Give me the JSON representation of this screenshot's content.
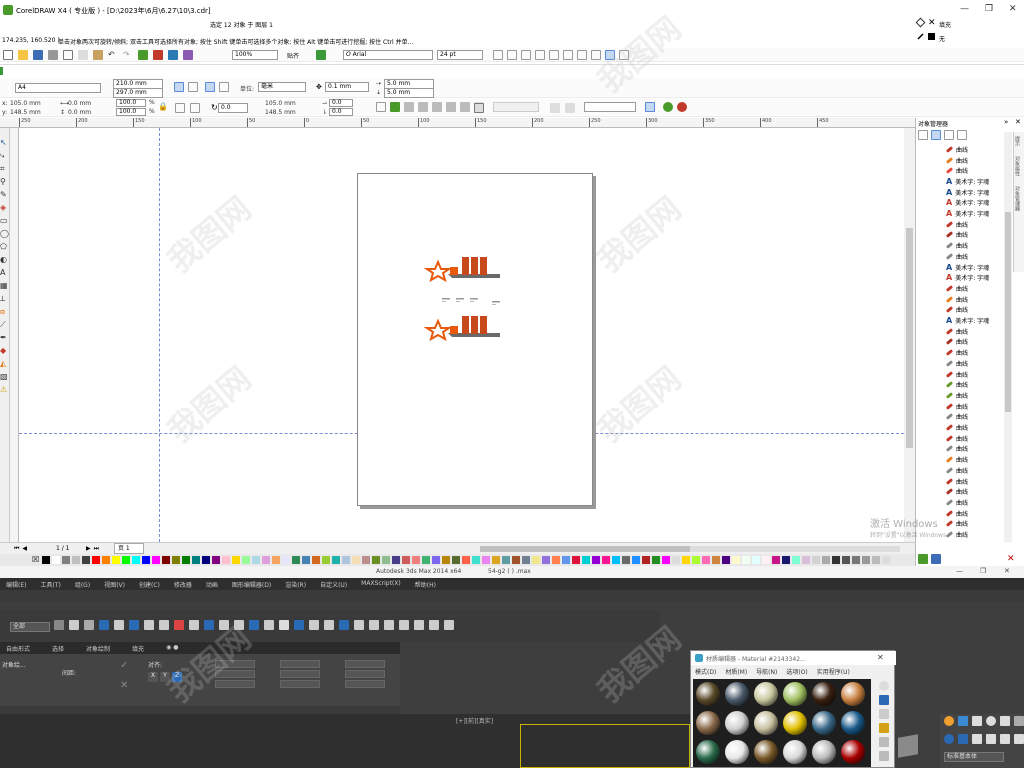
{
  "titlebar": {
    "app_title": "CorelDRAW X4 ( 专业版 ) - [D:\\2023年\\6月\\6.27\\10\\3.cdr]",
    "selection_info": "选定 12 对象 于 图层 1",
    "fill_label": "填充",
    "outline_label": "无",
    "minimize": "—",
    "restore": "❐",
    "close": "✕"
  },
  "status": {
    "coords": "174.235, 160.520 )",
    "hint": "单击对象两次可旋转/倾斜; 双击工具可选择所有对象; 按住 Shift 键单击可选择多个对象; 按住 Alt 键单击可进行挖掘; 按住 Ctrl 并单..."
  },
  "toolbar": {
    "zoom": "100%",
    "snap_label": "贴齐",
    "font_name": "Arial",
    "font_size": "24 pt"
  },
  "propbar": {
    "paper": "A4",
    "width": "210.0 mm",
    "height": "297.0 mm",
    "unit_label": "单位:",
    "unit": "毫米",
    "nudge": "0.1 mm",
    "dup_x": "5.0 mm",
    "dup_y": "5.0 mm"
  },
  "transform": {
    "x": "105.0 mm",
    "y": "148.5 mm",
    "w": "0.0 mm",
    "h": "0.0 mm",
    "sx": "100.0",
    "sy": "100.0",
    "pct": "%",
    "angle": "0.0",
    "cx": "105.0 mm",
    "cy": "148.5 mm",
    "skx": "0.0",
    "sky": "0.0"
  },
  "ruler": {
    "top_ticks": [
      "250",
      "200",
      "150",
      "100",
      "50",
      "0",
      "50",
      "100",
      "150",
      "200",
      "250",
      "300",
      "350",
      "400",
      "450"
    ]
  },
  "object_manager": {
    "title": "对象管理器",
    "items": [
      {
        "type": "curve",
        "label": "曲线",
        "color": "#c0392b"
      },
      {
        "type": "curve",
        "label": "曲线",
        "color": "#e67e22"
      },
      {
        "type": "curve",
        "label": "曲线",
        "color": "#e74c3c"
      },
      {
        "type": "text",
        "label": "美术字: 字魂"
      },
      {
        "type": "text",
        "label": "美术字: 字魂"
      },
      {
        "type": "text",
        "label": "美术字: 字魂",
        "color": "#c0392b"
      },
      {
        "type": "text",
        "label": "美术字: 字魂",
        "color": "#c0392b"
      },
      {
        "type": "curve",
        "label": "曲线",
        "color": "#c0392b"
      },
      {
        "type": "curve",
        "label": "曲线",
        "color": "#a93226"
      },
      {
        "type": "curve",
        "label": "曲线",
        "color": "#888"
      },
      {
        "type": "curve",
        "label": "曲线",
        "color": "#888"
      },
      {
        "type": "text",
        "label": "美术字: 字魂"
      },
      {
        "type": "text",
        "label": "美术字: 字魂",
        "color": "#c0392b"
      },
      {
        "type": "curve",
        "label": "曲线",
        "color": "#c0392b"
      },
      {
        "type": "curve",
        "label": "曲线",
        "color": "#e67e22"
      },
      {
        "type": "curve",
        "label": "曲线",
        "color": "#c0392b"
      },
      {
        "type": "text",
        "label": "美术字: 字魂"
      },
      {
        "type": "curve",
        "label": "曲线",
        "color": "#c0392b"
      },
      {
        "type": "curve",
        "label": "曲线",
        "color": "#a93226"
      },
      {
        "type": "curve",
        "label": "曲线",
        "color": "#c0392b"
      },
      {
        "type": "curve",
        "label": "曲线",
        "color": "#888"
      },
      {
        "type": "curve",
        "label": "曲线",
        "color": "#c0392b"
      },
      {
        "type": "curve",
        "label": "曲线",
        "color": "#6a9a2a"
      },
      {
        "type": "curve",
        "label": "曲线",
        "color": "#6a9a2a"
      },
      {
        "type": "curve",
        "label": "曲线",
        "color": "#c0392b"
      },
      {
        "type": "curve",
        "label": "曲线",
        "color": "#888"
      },
      {
        "type": "curve",
        "label": "曲线",
        "color": "#c0392b"
      },
      {
        "type": "curve",
        "label": "曲线",
        "color": "#c0392b"
      },
      {
        "type": "curve",
        "label": "曲线",
        "color": "#888"
      },
      {
        "type": "curve",
        "label": "曲线",
        "color": "#e67e22"
      },
      {
        "type": "curve",
        "label": "曲线",
        "color": "#888"
      },
      {
        "type": "curve",
        "label": "曲线",
        "color": "#c0392b"
      },
      {
        "type": "curve",
        "label": "曲线",
        "color": "#a93226"
      },
      {
        "type": "curve",
        "label": "曲线",
        "color": "#888"
      },
      {
        "type": "curve",
        "label": "曲线",
        "color": "#c0392b"
      },
      {
        "type": "curve",
        "label": "曲线",
        "color": "#c0392b"
      },
      {
        "type": "curve",
        "label": "曲线",
        "color": "#888"
      }
    ]
  },
  "pagenav": {
    "count": "1 / 1",
    "tab": "页 1"
  },
  "watermark_text": "激活 Windows",
  "watermark_sub": "转到\"设置\"以激活 Windows。",
  "max": {
    "title": "Autodesk 3ds Max 2014 x64",
    "file": "54-g2 ( ) .max",
    "menu": [
      "自由形式",
      "选择",
      "对象绘制",
      "填充",
      "◉ ●"
    ],
    "main_menu": [
      "编辑(E)",
      "工具(T)",
      "组(G)",
      "视图(V)",
      "创建(C)",
      "修改器",
      "动画",
      "图形编辑器(D)",
      "渲染(R)",
      "自定义(U)",
      "MAXScript(X)",
      "帮助(H)"
    ],
    "mat_editor": "材质编辑器 - Material #2143342...",
    "mat_menu": [
      "模式(D)",
      "材质(M)",
      "导航(N)",
      "选项(O)",
      "实用程序(U)"
    ]
  },
  "palette": [
    "#000",
    "#fff",
    "#808080",
    "#c0c0c0",
    "#404040",
    "#ff0000",
    "#ff8000",
    "#ffff00",
    "#00ff00",
    "#00ffff",
    "#0000ff",
    "#ff00ff",
    "#800000",
    "#808000",
    "#008000",
    "#008080",
    "#000080",
    "#800080",
    "#ffc0cb",
    "#ffd700",
    "#98fb98",
    "#add8e6",
    "#dda0dd",
    "#f4a460",
    "#e6e6fa",
    "#2e8b57",
    "#4682b4",
    "#d2691e",
    "#9acd32",
    "#20b2aa",
    "#b0c4de",
    "#f5deb3",
    "#bc8f8f",
    "#6b8e23",
    "#8fbc8f",
    "#483d8b",
    "#cd5c5c",
    "#f08080",
    "#3cb371",
    "#7b68ee",
    "#b8860b",
    "#556b2f",
    "#ff6347",
    "#40e0d0",
    "#ee82ee",
    "#daa520",
    "#5f9ea0",
    "#a0522d",
    "#708090",
    "#f0e68c",
    "#9370db",
    "#ff7f50",
    "#6495ed",
    "#dc143c",
    "#00ced1",
    "#9400d3",
    "#ff1493",
    "#00bfff",
    "#696969",
    "#1e90ff",
    "#b22222",
    "#228b22",
    "#ff00ff",
    "#dcdcdc",
    "#ffd700",
    "#adff2f",
    "#ff69b4",
    "#cd853f",
    "#4b0082",
    "#fffacd",
    "#f0fff0",
    "#e0ffff",
    "#fff0f5",
    "#c71585",
    "#191970",
    "#7fffd4",
    "#d8bfd8",
    "#d3d3d3",
    "#a9a9a9",
    "#333",
    "#555",
    "#777",
    "#999",
    "#bbb",
    "#ddd"
  ]
}
